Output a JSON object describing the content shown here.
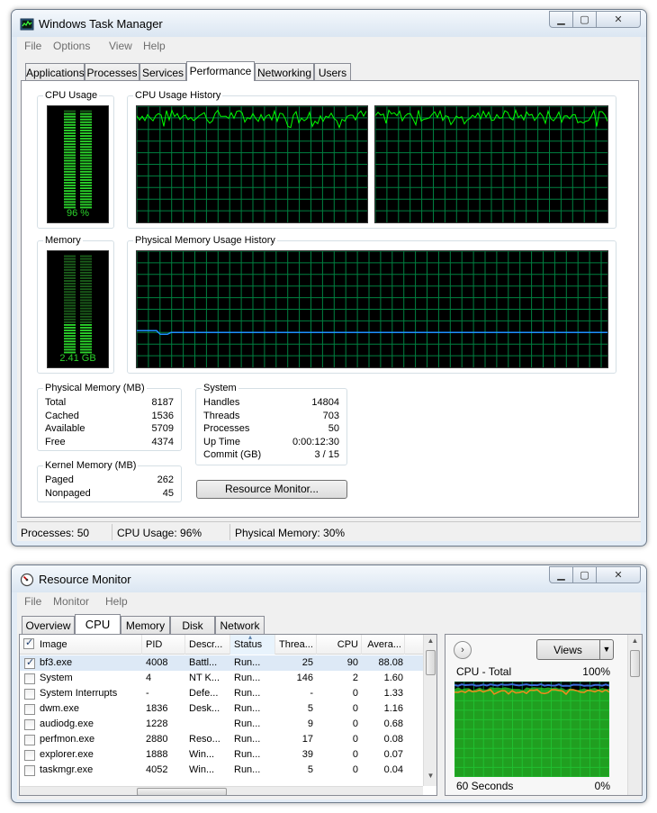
{
  "task_manager": {
    "title": "Windows Task Manager",
    "menu": [
      "File",
      "Options",
      "View",
      "Help"
    ],
    "tabs": [
      "Applications",
      "Processes",
      "Services",
      "Performance",
      "Networking",
      "Users"
    ],
    "active_tab": "Performance",
    "cpu_usage": {
      "label": "CPU Usage",
      "value_text": "96 %",
      "percent": 96
    },
    "cpu_history": {
      "label": "CPU Usage History"
    },
    "memory": {
      "label": "Memory",
      "value_text": "2.41 GB",
      "fraction": 0.3
    },
    "memory_history": {
      "label": "Physical Memory Usage History"
    },
    "physical_memory": {
      "label": "Physical Memory (MB)",
      "rows": [
        {
          "key": "Total",
          "value": "8187"
        },
        {
          "key": "Cached",
          "value": "1536"
        },
        {
          "key": "Available",
          "value": "5709"
        },
        {
          "key": "Free",
          "value": "4374"
        }
      ]
    },
    "kernel_memory": {
      "label": "Kernel Memory (MB)",
      "rows": [
        {
          "key": "Paged",
          "value": "262"
        },
        {
          "key": "Nonpaged",
          "value": "45"
        }
      ]
    },
    "system": {
      "label": "System",
      "rows": [
        {
          "key": "Handles",
          "value": "14804"
        },
        {
          "key": "Threads",
          "value": "703"
        },
        {
          "key": "Processes",
          "value": "50"
        },
        {
          "key": "Up Time",
          "value": "0:00:12:30"
        },
        {
          "key": "Commit (GB)",
          "value": "3 / 15"
        }
      ]
    },
    "resource_monitor_button": "Resource Monitor...",
    "status": {
      "processes": "Processes: 50",
      "cpu": "CPU Usage: 96%",
      "memory": "Physical Memory: 30%"
    }
  },
  "resource_monitor": {
    "title": "Resource Monitor",
    "menu": [
      "File",
      "Monitor",
      "Help"
    ],
    "tabs": [
      "Overview",
      "CPU",
      "Memory",
      "Disk",
      "Network"
    ],
    "active_tab": "CPU",
    "columns": [
      "Image",
      "PID",
      "Descr...",
      "Status",
      "Threa...",
      "CPU",
      "Avera..."
    ],
    "rows": [
      {
        "image": "bf3.exe",
        "pid": "4008",
        "desc": "Battl...",
        "status": "Run...",
        "threads": "25",
        "cpu": "90",
        "avg": "88.08",
        "checked": true
      },
      {
        "image": "System",
        "pid": "4",
        "desc": "NT K...",
        "status": "Run...",
        "threads": "146",
        "cpu": "2",
        "avg": "1.60",
        "checked": false
      },
      {
        "image": "System Interrupts",
        "pid": "-",
        "desc": "Defe...",
        "status": "Run...",
        "threads": "-",
        "cpu": "0",
        "avg": "1.33",
        "checked": false
      },
      {
        "image": "dwm.exe",
        "pid": "1836",
        "desc": "Desk...",
        "status": "Run...",
        "threads": "5",
        "cpu": "0",
        "avg": "1.16",
        "checked": false
      },
      {
        "image": "audiodg.exe",
        "pid": "1228",
        "desc": "",
        "status": "Run...",
        "threads": "9",
        "cpu": "0",
        "avg": "0.68",
        "checked": false
      },
      {
        "image": "perfmon.exe",
        "pid": "2880",
        "desc": "Reso...",
        "status": "Run...",
        "threads": "17",
        "cpu": "0",
        "avg": "0.08",
        "checked": false
      },
      {
        "image": "explorer.exe",
        "pid": "1888",
        "desc": "Win...",
        "status": "Run...",
        "threads": "39",
        "cpu": "0",
        "avg": "0.07",
        "checked": false
      },
      {
        "image": "taskmgr.exe",
        "pid": "4052",
        "desc": "Win...",
        "status": "Run...",
        "threads": "5",
        "cpu": "0",
        "avg": "0.04",
        "checked": false
      }
    ],
    "views_button": "Views",
    "graph": {
      "title": "CPU - Total",
      "max": "100%",
      "time": "60 Seconds",
      "min": "0%"
    }
  },
  "colors": {
    "graph_bg": "#000000",
    "graph_grid": "#008040",
    "graph_line": "#00ff00",
    "memory_line": "#1e90ff",
    "meter_on": "#2bd42b",
    "meter_off": "#1b5e1b"
  },
  "icons": [
    "task-manager-icon",
    "resource-monitor-icon",
    "minimize-icon",
    "maximize-icon",
    "close-icon",
    "sort-ascending-icon",
    "expand-arrow-icon",
    "dropdown-arrow-icon"
  ]
}
